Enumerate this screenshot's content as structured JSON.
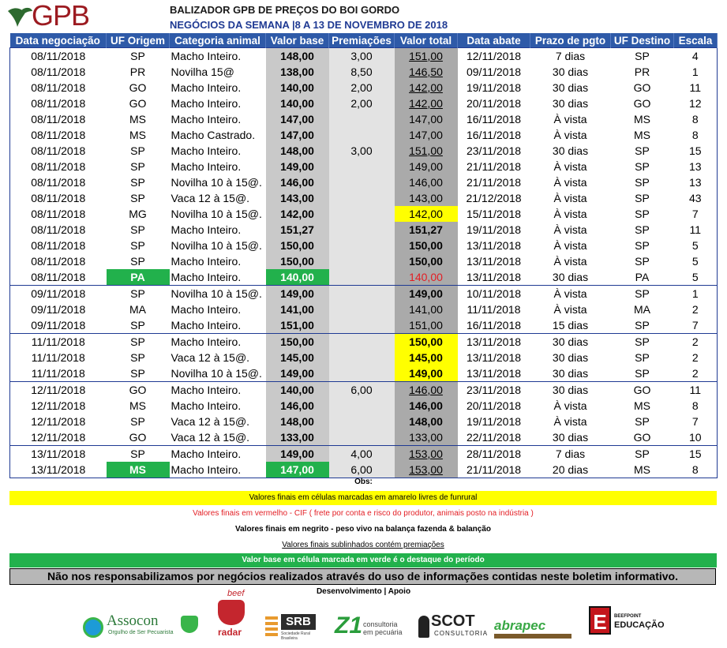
{
  "header": {
    "logo_text": "GPB",
    "title": "BALIZADOR GPB DE PREÇOS DO BOI GORDO",
    "subtitle": "NEGÓCIOS DA SEMANA |8 A 13 DE NOVEMBRO DE 2018"
  },
  "colors": {
    "header_blue": "#2e5aa8",
    "highlight_yellow": "#ffff00",
    "highlight_green": "#22b14c",
    "cif_red": "#e31e24"
  },
  "table": {
    "columns": [
      "Data negociação",
      "UF Origem",
      "Categoria animal",
      "Valor base",
      "Premiações",
      "Valor total",
      "Data abate",
      "Prazo de pgto",
      "UF Destino",
      "Escala"
    ],
    "rows": [
      {
        "date": "08/11/2018",
        "uf_origem": "SP",
        "categoria": "Macho Inteiro.",
        "valor_base": "148,00",
        "premiacoes": "3,00",
        "valor_total": "151,00",
        "data_abate": "12/11/2018",
        "prazo": "7 dias",
        "uf_destino": "SP",
        "escala": "4",
        "vt_style": "underline"
      },
      {
        "date": "08/11/2018",
        "uf_origem": "PR",
        "categoria": "Novilha 15@",
        "valor_base": "138,00",
        "premiacoes": "8,50",
        "valor_total": "146,50",
        "data_abate": "09/11/2018",
        "prazo": "30 dias",
        "uf_destino": "PR",
        "escala": "1",
        "vt_style": "underline"
      },
      {
        "date": "08/11/2018",
        "uf_origem": "GO",
        "categoria": "Macho Inteiro.",
        "valor_base": "140,00",
        "premiacoes": "2,00",
        "valor_total": "142,00",
        "data_abate": "19/11/2018",
        "prazo": "30 dias",
        "uf_destino": "GO",
        "escala": "11",
        "vt_style": "underline"
      },
      {
        "date": "08/11/2018",
        "uf_origem": "GO",
        "categoria": "Macho Inteiro.",
        "valor_base": "140,00",
        "premiacoes": "2,00",
        "valor_total": "142,00",
        "data_abate": "20/11/2018",
        "prazo": "30 dias",
        "uf_destino": "GO",
        "escala": "12",
        "vt_style": "underline"
      },
      {
        "date": "08/11/2018",
        "uf_origem": "MS",
        "categoria": "Macho Inteiro.",
        "valor_base": "147,00",
        "premiacoes": "",
        "valor_total": "147,00",
        "data_abate": "16/11/2018",
        "prazo": "À vista",
        "uf_destino": "MS",
        "escala": "8",
        "vt_style": ""
      },
      {
        "date": "08/11/2018",
        "uf_origem": "MS",
        "categoria": "Macho Castrado.",
        "valor_base": "147,00",
        "premiacoes": "",
        "valor_total": "147,00",
        "data_abate": "16/11/2018",
        "prazo": "À vista",
        "uf_destino": "MS",
        "escala": "8",
        "vt_style": ""
      },
      {
        "date": "08/11/2018",
        "uf_origem": "SP",
        "categoria": "Macho Inteiro.",
        "valor_base": "148,00",
        "premiacoes": "3,00",
        "valor_total": "151,00",
        "data_abate": "23/11/2018",
        "prazo": "30 dias",
        "uf_destino": "SP",
        "escala": "15",
        "vt_style": "underline"
      },
      {
        "date": "08/11/2018",
        "uf_origem": "SP",
        "categoria": "Macho Inteiro.",
        "valor_base": "149,00",
        "premiacoes": "",
        "valor_total": "149,00",
        "data_abate": "21/11/2018",
        "prazo": "À vista",
        "uf_destino": "SP",
        "escala": "13",
        "vt_style": ""
      },
      {
        "date": "08/11/2018",
        "uf_origem": "SP",
        "categoria": "Novilha 10 à 15@.",
        "valor_base": "146,00",
        "premiacoes": "",
        "valor_total": "146,00",
        "data_abate": "21/11/2018",
        "prazo": "À vista",
        "uf_destino": "SP",
        "escala": "13",
        "vt_style": ""
      },
      {
        "date": "08/11/2018",
        "uf_origem": "SP",
        "categoria": "Vaca 12 à 15@.",
        "valor_base": "143,00",
        "premiacoes": "",
        "valor_total": "143,00",
        "data_abate": "21/12/2018",
        "prazo": "À vista",
        "uf_destino": "SP",
        "escala": "43",
        "vt_style": ""
      },
      {
        "date": "08/11/2018",
        "uf_origem": "MG",
        "categoria": "Novilha 10 à 15@.",
        "valor_base": "142,00",
        "premiacoes": "",
        "valor_total": "142,00",
        "data_abate": "15/11/2018",
        "prazo": "À vista",
        "uf_destino": "SP",
        "escala": "7",
        "vt_style": "yellow"
      },
      {
        "date": "08/11/2018",
        "uf_origem": "SP",
        "categoria": "Macho Inteiro.",
        "valor_base": "151,27",
        "premiacoes": "",
        "valor_total": "151,27",
        "data_abate": "19/11/2018",
        "prazo": "À vista",
        "uf_destino": "SP",
        "escala": "11",
        "vt_style": "bold"
      },
      {
        "date": "08/11/2018",
        "uf_origem": "SP",
        "categoria": "Novilha 10 à 15@.",
        "valor_base": "150,00",
        "premiacoes": "",
        "valor_total": "150,00",
        "data_abate": "13/11/2018",
        "prazo": "À vista",
        "uf_destino": "SP",
        "escala": "5",
        "vt_style": "bold"
      },
      {
        "date": "08/11/2018",
        "uf_origem": "SP",
        "categoria": "Macho Inteiro.",
        "valor_base": "150,00",
        "premiacoes": "",
        "valor_total": "150,00",
        "data_abate": "13/11/2018",
        "prazo": "À vista",
        "uf_destino": "SP",
        "escala": "5",
        "vt_style": "bold"
      },
      {
        "date": "08/11/2018",
        "uf_origem": "PA",
        "categoria": "Macho Inteiro.",
        "valor_base": "140,00",
        "premiacoes": "",
        "valor_total": "140,00",
        "data_abate": "13/11/2018",
        "prazo": "30 dias",
        "uf_destino": "PA",
        "escala": "5",
        "vt_style": "red",
        "green": true
      },
      {
        "date": "09/11/2018",
        "uf_origem": "SP",
        "categoria": "Novilha 10 à 15@.",
        "valor_base": "149,00",
        "premiacoes": "",
        "valor_total": "149,00",
        "data_abate": "10/11/2018",
        "prazo": "À vista",
        "uf_destino": "SP",
        "escala": "1",
        "vt_style": "bold",
        "sep": true
      },
      {
        "date": "09/11/2018",
        "uf_origem": "MA",
        "categoria": "Macho Inteiro.",
        "valor_base": "141,00",
        "premiacoes": "",
        "valor_total": "141,00",
        "data_abate": "11/11/2018",
        "prazo": "À vista",
        "uf_destino": "MA",
        "escala": "2",
        "vt_style": ""
      },
      {
        "date": "09/11/2018",
        "uf_origem": "SP",
        "categoria": "Macho Inteiro.",
        "valor_base": "151,00",
        "premiacoes": "",
        "valor_total": "151,00",
        "data_abate": "16/11/2018",
        "prazo": "15 dias",
        "uf_destino": "SP",
        "escala": "7",
        "vt_style": ""
      },
      {
        "date": "11/11/2018",
        "uf_origem": "SP",
        "categoria": "Macho Inteiro.",
        "valor_base": "150,00",
        "premiacoes": "",
        "valor_total": "150,00",
        "data_abate": "13/11/2018",
        "prazo": "30 dias",
        "uf_destino": "SP",
        "escala": "2",
        "vt_style": "yellow-bold",
        "sep": true
      },
      {
        "date": "11/11/2018",
        "uf_origem": "SP",
        "categoria": "Vaca 12 à 15@.",
        "valor_base": "145,00",
        "premiacoes": "",
        "valor_total": "145,00",
        "data_abate": "13/11/2018",
        "prazo": "30 dias",
        "uf_destino": "SP",
        "escala": "2",
        "vt_style": "yellow-bold"
      },
      {
        "date": "11/11/2018",
        "uf_origem": "SP",
        "categoria": "Novilha 10 à 15@.",
        "valor_base": "149,00",
        "premiacoes": "",
        "valor_total": "149,00",
        "data_abate": "13/11/2018",
        "prazo": "30 dias",
        "uf_destino": "SP",
        "escala": "2",
        "vt_style": "yellow-bold"
      },
      {
        "date": "12/11/2018",
        "uf_origem": "GO",
        "categoria": "Macho Inteiro.",
        "valor_base": "140,00",
        "premiacoes": "6,00",
        "valor_total": "146,00",
        "data_abate": "23/11/2018",
        "prazo": "30 dias",
        "uf_destino": "GO",
        "escala": "11",
        "vt_style": "underline",
        "sep": true
      },
      {
        "date": "12/11/2018",
        "uf_origem": "MS",
        "categoria": "Macho Inteiro.",
        "valor_base": "146,00",
        "premiacoes": "",
        "valor_total": "146,00",
        "data_abate": "20/11/2018",
        "prazo": "À vista",
        "uf_destino": "MS",
        "escala": "8",
        "vt_style": "bold"
      },
      {
        "date": "12/11/2018",
        "uf_origem": "SP",
        "categoria": "Vaca 12 à 15@.",
        "valor_base": "148,00",
        "premiacoes": "",
        "valor_total": "148,00",
        "data_abate": "19/11/2018",
        "prazo": "À vista",
        "uf_destino": "SP",
        "escala": "7",
        "vt_style": "bold"
      },
      {
        "date": "12/11/2018",
        "uf_origem": "GO",
        "categoria": "Vaca 12 à 15@.",
        "valor_base": "133,00",
        "premiacoes": "",
        "valor_total": "133,00",
        "data_abate": "22/11/2018",
        "prazo": "30 dias",
        "uf_destino": "GO",
        "escala": "10",
        "vt_style": ""
      },
      {
        "date": "13/11/2018",
        "uf_origem": "SP",
        "categoria": "Macho Inteiro.",
        "valor_base": "149,00",
        "premiacoes": "4,00",
        "valor_total": "153,00",
        "data_abate": "28/11/2018",
        "prazo": "7 dias",
        "uf_destino": "SP",
        "escala": "15",
        "vt_style": "underline",
        "sep": true
      },
      {
        "date": "13/11/2018",
        "uf_origem": "MS",
        "categoria": "Macho Inteiro.",
        "valor_base": "147,00",
        "premiacoes": "6,00",
        "valor_total": "153,00",
        "data_abate": "21/11/2018",
        "prazo": "20 dias",
        "uf_destino": "MS",
        "escala": "8",
        "vt_style": "underline",
        "green": true
      }
    ]
  },
  "notes": {
    "obs_label": "Obs:",
    "yellow": "Valores finais em células marcadas em amarelo livres de funrural",
    "red": "Valores finais em vermelho - CIF ( frete por conta e risco do produtor, animais posto na indústria )",
    "bold": "Valores finais em negrito - peso vivo na balança fazenda & balanção",
    "underline": "Valores finais sublinhados contém premiações",
    "green": "Valor base em célula marcada em verde é o destaque do período",
    "disclaimer": "Não nos responsabilizamos por negócios realizados através do uso de informações contidas neste boletim informativo.",
    "dev_label": "Desenvolvimento | Apoio"
  },
  "sponsors": {
    "assocon": {
      "name": "Assocon",
      "tagline": "Orgulho de Ser Pecuarista",
      "icon": "cow-head-icon"
    },
    "beef_radar": {
      "top": "beef",
      "bottom": "radar",
      "icon": "bull-head-icon"
    },
    "srb": {
      "name": "SRB",
      "tagline": "Sociedade Rural Brasileira",
      "icon": "wheat-icon"
    },
    "z1": {
      "mark": "Z1",
      "line1": "consultoria",
      "line2": "em pecuária"
    },
    "scot": {
      "name": "SCOT",
      "tagline": "CONSULTORIA",
      "icon": "farmer-icon"
    },
    "abrapec": {
      "name": "abrapec"
    },
    "beefpoint": {
      "mark": "E",
      "line1": "BEEFPOINT",
      "line2": "EDUCAÇÃO"
    }
  }
}
